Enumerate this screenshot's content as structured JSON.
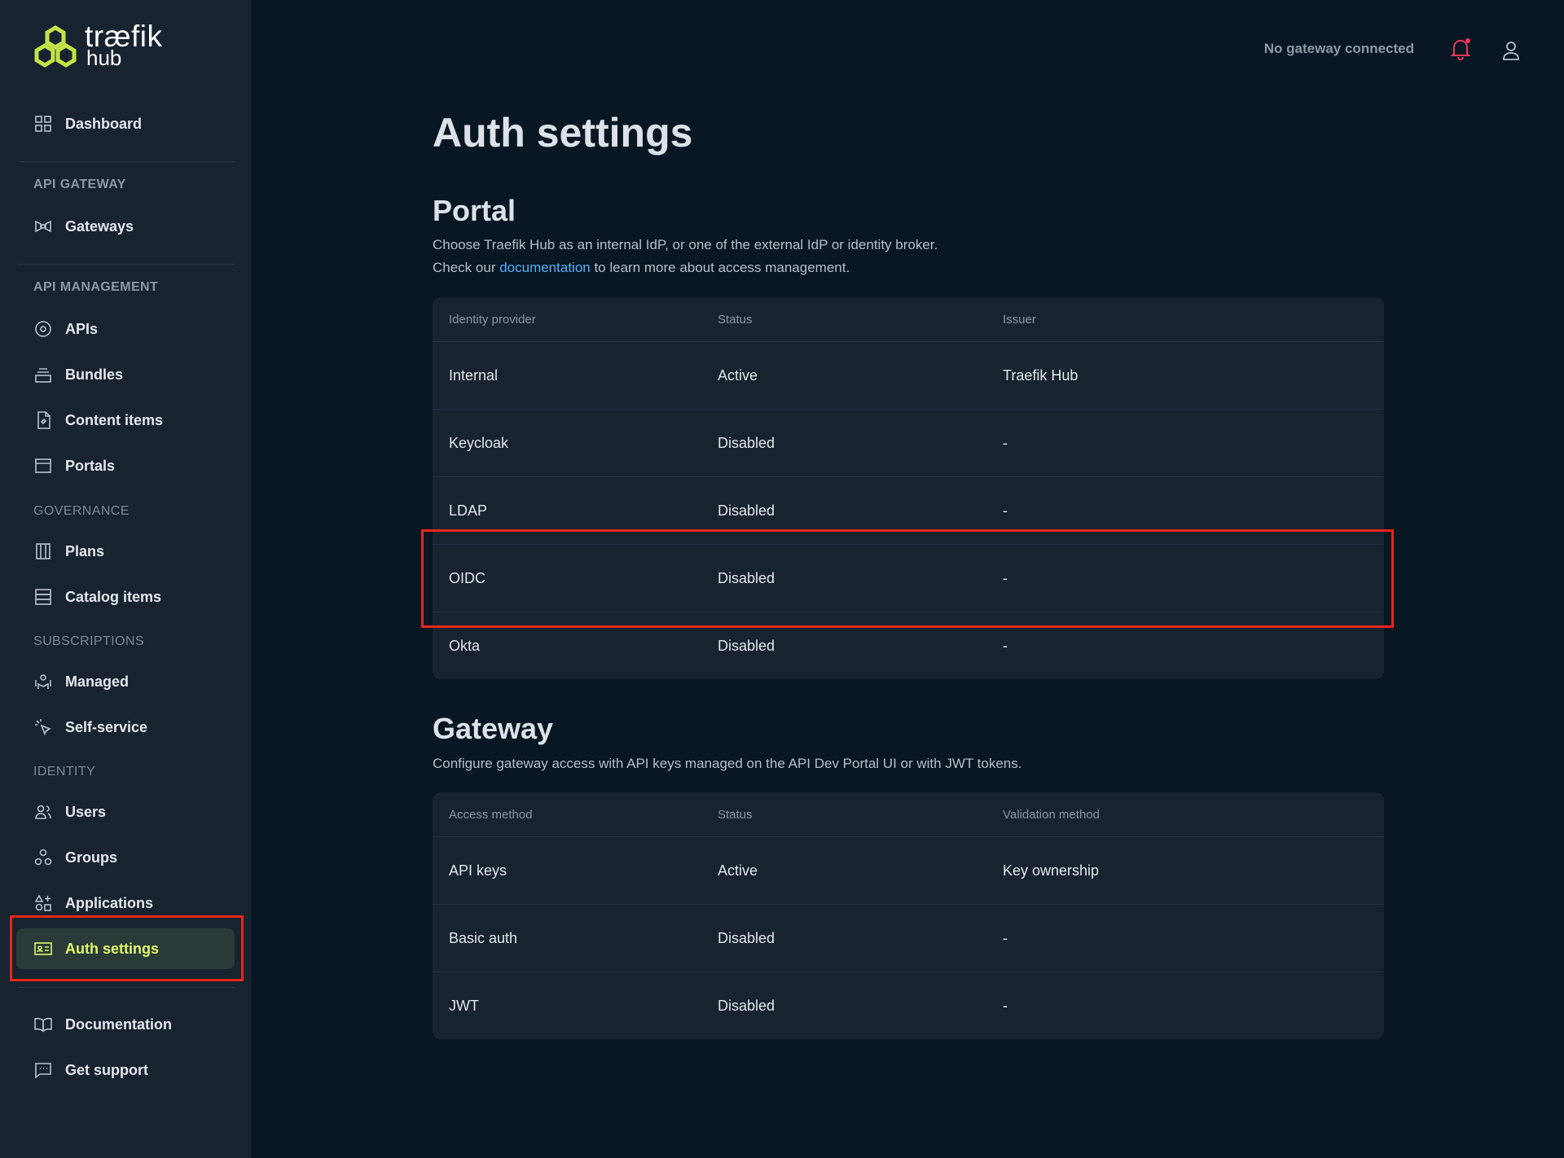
{
  "brand": {
    "name": "træfik",
    "sub": "hub"
  },
  "topbar": {
    "status": "No gateway connected"
  },
  "sidebar": {
    "dashboard": "Dashboard",
    "sections": {
      "api_gateway": "API GATEWAY",
      "api_management": "API MANAGEMENT",
      "governance": "GOVERNANCE",
      "subscriptions": "SUBSCRIPTIONS",
      "identity": "IDENTITY"
    },
    "items": {
      "gateways": "Gateways",
      "apis": "APIs",
      "bundles": "Bundles",
      "content_items": "Content items",
      "portals": "Portals",
      "plans": "Plans",
      "catalog_items": "Catalog items",
      "managed": "Managed",
      "self_service": "Self-service",
      "users": "Users",
      "groups": "Groups",
      "applications": "Applications",
      "auth_settings": "Auth settings",
      "documentation": "Documentation",
      "get_support": "Get support"
    }
  },
  "page": {
    "title": "Auth settings",
    "portal": {
      "title": "Portal",
      "desc_line1": "Choose Traefik Hub as an internal IdP, or one of the external IdP or identity broker.",
      "desc_pre": "Check our ",
      "desc_link": "documentation",
      "desc_post": " to learn more about access management.",
      "columns": [
        "Identity provider",
        "Status",
        "Issuer"
      ],
      "rows": [
        [
          "Internal",
          "Active",
          "Traefik Hub"
        ],
        [
          "Keycloak",
          "Disabled",
          "-"
        ],
        [
          "LDAP",
          "Disabled",
          "-"
        ],
        [
          "OIDC",
          "Disabled",
          "-"
        ],
        [
          "Okta",
          "Disabled",
          "-"
        ]
      ]
    },
    "gateway": {
      "title": "Gateway",
      "desc": "Configure gateway access with API keys managed on the API Dev Portal UI or with JWT tokens.",
      "columns": [
        "Access method",
        "Status",
        "Validation method"
      ],
      "rows": [
        [
          "API keys",
          "Active",
          "Key ownership"
        ],
        [
          "Basic auth",
          "Disabled",
          "-"
        ],
        [
          "JWT",
          "Disabled",
          "-"
        ]
      ]
    }
  },
  "colors": {
    "accent": "#dff86a",
    "highlight": "#e8261b",
    "link": "#4fb1f5",
    "bell": "#f0365a"
  }
}
